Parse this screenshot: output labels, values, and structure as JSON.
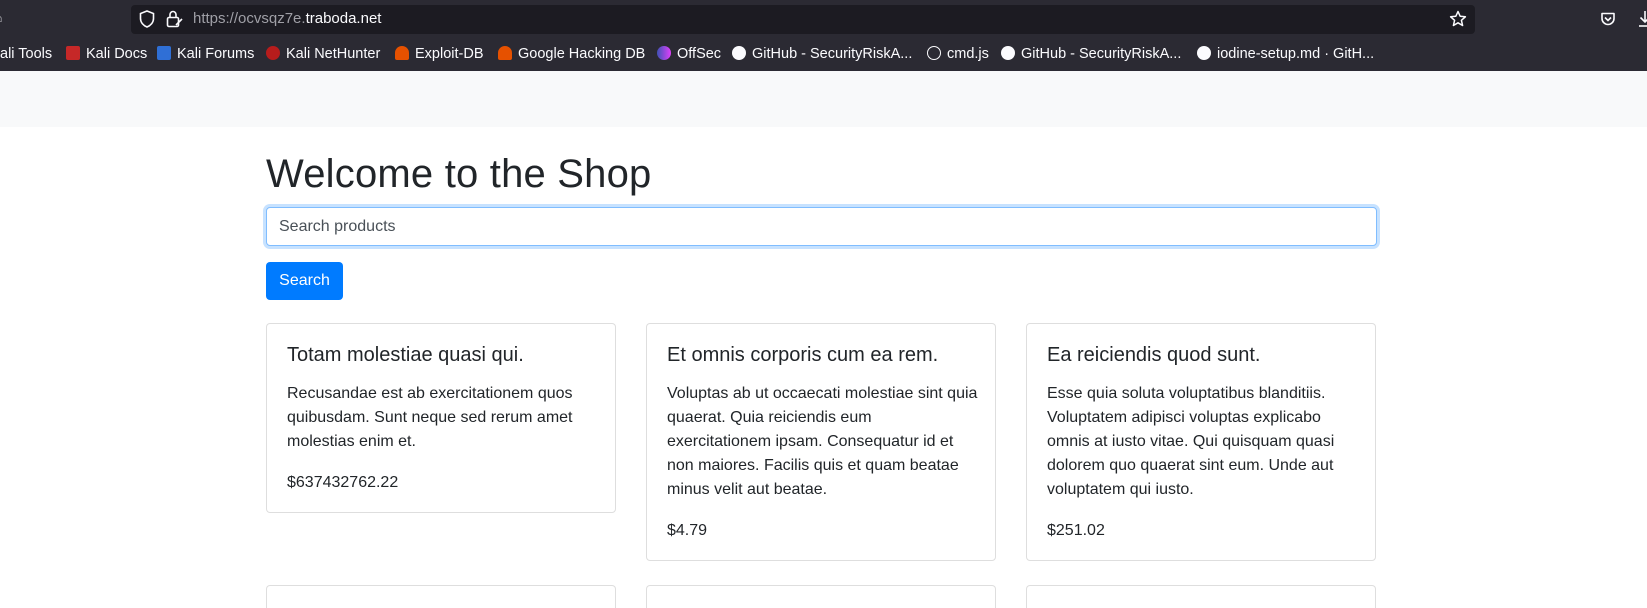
{
  "browser": {
    "url_prefix": "https://ocvsqz7e.",
    "url_host": "traboda.net",
    "bookmarks": [
      {
        "label": "ali Tools",
        "icon": "kali-icon"
      },
      {
        "label": "Kali Docs",
        "icon": "kali-docs-icon"
      },
      {
        "label": "Kali Forums",
        "icon": "kali-forums-icon"
      },
      {
        "label": "Kali NetHunter",
        "icon": "nethunter-icon"
      },
      {
        "label": "Exploit-DB",
        "icon": "exploit-db-icon"
      },
      {
        "label": "Google Hacking DB",
        "icon": "ghdb-icon"
      },
      {
        "label": "OffSec",
        "icon": "offsec-icon"
      },
      {
        "label": "GitHub - SecurityRiskA...",
        "icon": "github-icon"
      },
      {
        "label": "cmd.js",
        "icon": "globe-icon"
      },
      {
        "label": "GitHub - SecurityRiskA...",
        "icon": "github-icon"
      },
      {
        "label": "iodine-setup.md · GitH...",
        "icon": "github-icon"
      }
    ]
  },
  "page": {
    "title": "Welcome to the Shop",
    "search": {
      "placeholder": "Search products",
      "button_label": "Search"
    },
    "products": [
      {
        "name": "Totam molestiae quasi qui.",
        "description": "Recusandae est ab exercitationem quos quibusdam. Sunt neque sed rerum amet molestias enim et.",
        "price": "$637432762.22"
      },
      {
        "name": "Et omnis corporis cum ea rem.",
        "description": "Voluptas ab ut occaecati molestiae sint quia quaerat. Quia reiciendis eum exercitationem ipsam. Consequatur id et non maiores. Facilis quis et quam beatae minus velit aut beatae.",
        "price": "$4.79"
      },
      {
        "name": "Ea reiciendis quod sunt.",
        "description": "Esse quia soluta voluptatibus blanditiis. Voluptatem adipisci voluptas explicabo omnis at iusto vitae. Qui quisquam quasi dolorem quo quaerat sint eum. Unde aut voluptatem qui iusto.",
        "price": "$251.02"
      }
    ]
  },
  "colors": {
    "chrome_bg": "#2b2a33",
    "urlbar_bg": "#1c1b22",
    "navbar_bg": "#f8f9fa",
    "primary": "#007bff",
    "text": "#212529"
  }
}
